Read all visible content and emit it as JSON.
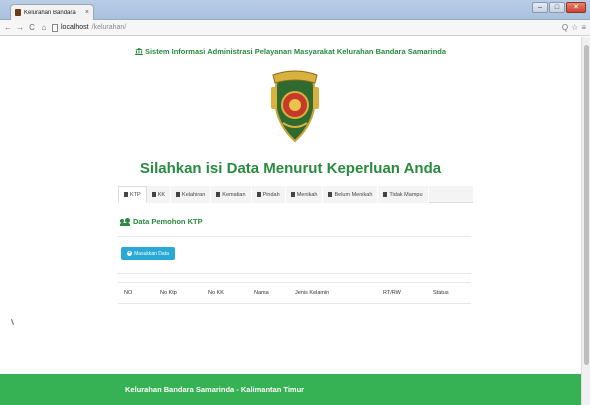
{
  "browser": {
    "tab_title": "Kelurahan Bandara",
    "tab_close": "×",
    "window_buttons": [
      "–",
      "□",
      "✕"
    ],
    "nav": {
      "back": "←",
      "forward": "→",
      "reload": "C",
      "home": "⌂"
    },
    "address": {
      "host": "localhost",
      "path": "/kelurahan/"
    },
    "address_icons": {
      "search": "Q",
      "star": "☆",
      "menu": "≡"
    }
  },
  "header": {
    "system_title": "Sistem Informasi Administrasi Pelayanan Masyarakat Kelurahan Bandara Samarinda",
    "logo_icon": "city-emblem-logo"
  },
  "main": {
    "heading": "Silahkan isi Data Menurut Keperluan Anda",
    "tabs": [
      {
        "label": "KTP",
        "active": true
      },
      {
        "label": "KK",
        "active": false
      },
      {
        "label": "Kelahiran",
        "active": false
      },
      {
        "label": "Kematian",
        "active": false
      },
      {
        "label": "Pindah",
        "active": false
      },
      {
        "label": "Menikah",
        "active": false
      },
      {
        "label": "Belum Menikah",
        "active": false
      },
      {
        "label": "Tidak Mampu",
        "active": false
      }
    ],
    "section_title": "Data Pemohon KTP",
    "add_button": "Masukkan Data",
    "table_headers": [
      "NO",
      "No Ktp",
      "No KK",
      "Nama",
      "Jenis Kelamin",
      "RT/RW",
      "Status"
    ]
  },
  "footer": {
    "text": "Kelurahan Bandara Samarinda - Kalimantan Timur"
  },
  "colors": {
    "brand_green": "#2a8a3f",
    "footer_green": "#36b255",
    "button_blue": "#29a9d6"
  }
}
